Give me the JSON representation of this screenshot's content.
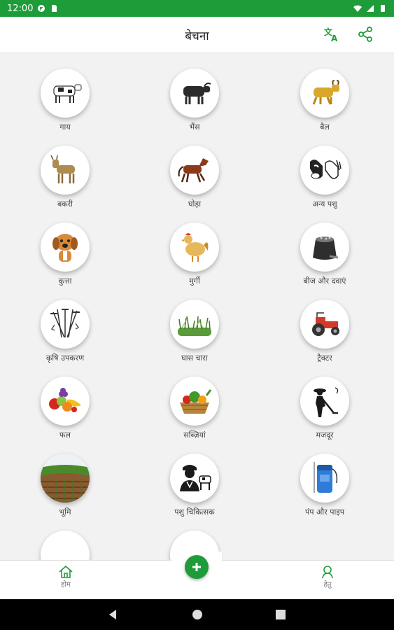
{
  "status_bar": {
    "time": "12:00"
  },
  "app_bar": {
    "title": "बेचना"
  },
  "categories": [
    {
      "label": "गाय",
      "icon": "cow-icon"
    },
    {
      "label": "भैंस",
      "icon": "buffalo-icon"
    },
    {
      "label": "बैल",
      "icon": "bull-icon"
    },
    {
      "label": "बकरी",
      "icon": "goat-icon"
    },
    {
      "label": "घोड़ा",
      "icon": "horse-icon"
    },
    {
      "label": "अन्य पशु",
      "icon": "other-animals-icon"
    },
    {
      "label": "कुत्ता",
      "icon": "dog-icon"
    },
    {
      "label": "मुर्गी",
      "icon": "hen-icon"
    },
    {
      "label": "बीज और दवाएं",
      "icon": "seed-sack-icon"
    },
    {
      "label": "कृषि उपकरण",
      "icon": "farm-tools-icon"
    },
    {
      "label": "घास चारा",
      "icon": "grass-fodder-icon"
    },
    {
      "label": "ट्रैक्टर",
      "icon": "tractor-icon"
    },
    {
      "label": "फल",
      "icon": "fruits-icon"
    },
    {
      "label": "सब्ज़ियां",
      "icon": "vegetables-icon"
    },
    {
      "label": "मजदूर",
      "icon": "laborer-icon"
    },
    {
      "label": "भूमि",
      "icon": "land-icon"
    },
    {
      "label": "पशु चिकित्सक",
      "icon": "veterinarian-icon"
    },
    {
      "label": "पंप और पाइप",
      "icon": "pump-icon"
    }
  ],
  "bottom_nav": {
    "home_label": "होम",
    "profile_label": "हेतु"
  },
  "colors": {
    "primary": "#1e9c3a",
    "background": "#f2f2f2"
  }
}
